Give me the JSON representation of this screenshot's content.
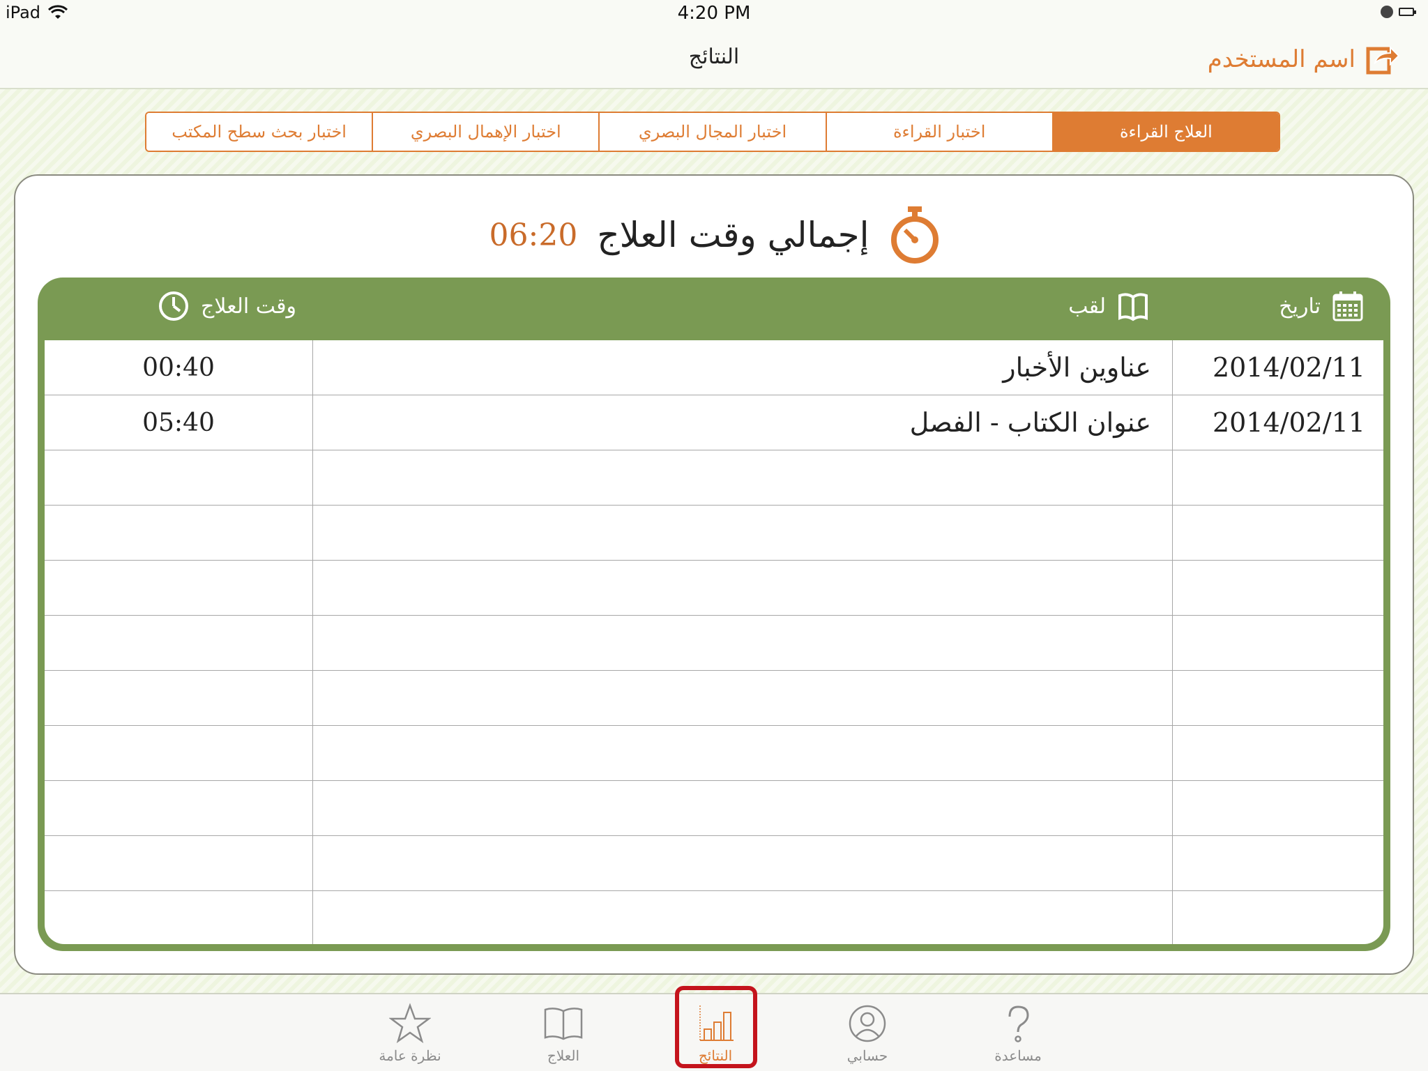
{
  "status_bar": {
    "device": "iPad",
    "time": "4:20 PM"
  },
  "nav": {
    "title": "النتائج",
    "user_label": "اسم المستخدم"
  },
  "tabs": [
    {
      "label": "العلاج القراءة",
      "active": true
    },
    {
      "label": "اختبار القراءة",
      "active": false
    },
    {
      "label": "اختبار المجال البصري",
      "active": false
    },
    {
      "label": "اختبار الإهمال البصري",
      "active": false
    },
    {
      "label": "اختبار بحث سطح المكتب",
      "active": false
    }
  ],
  "summary": {
    "label": "إجمالي وقت العلاج",
    "value": "06:20"
  },
  "table": {
    "headers": {
      "date": "تاريخ",
      "title": "لقب",
      "time": "وقت العلاج"
    },
    "rows": [
      {
        "date": "2014/02/11",
        "title": "عناوين الأخبار",
        "time": "00:40"
      },
      {
        "date": "2014/02/11",
        "title": "عنوان الكتاب - الفصل",
        "time": "05:40"
      },
      {
        "date": "",
        "title": "",
        "time": ""
      },
      {
        "date": "",
        "title": "",
        "time": ""
      },
      {
        "date": "",
        "title": "",
        "time": ""
      },
      {
        "date": "",
        "title": "",
        "time": ""
      },
      {
        "date": "",
        "title": "",
        "time": ""
      },
      {
        "date": "",
        "title": "",
        "time": ""
      },
      {
        "date": "",
        "title": "",
        "time": ""
      },
      {
        "date": "",
        "title": "",
        "time": ""
      },
      {
        "date": "",
        "title": "",
        "time": ""
      }
    ]
  },
  "tabbar": {
    "overview": "نظرة عامة",
    "treatment": "العلاج",
    "results": "النتائج",
    "account": "حسابي",
    "help": "مساعدة"
  },
  "colors": {
    "accent": "#de7c33",
    "table_header": "#7a9a53",
    "highlight": "#c4141c"
  }
}
